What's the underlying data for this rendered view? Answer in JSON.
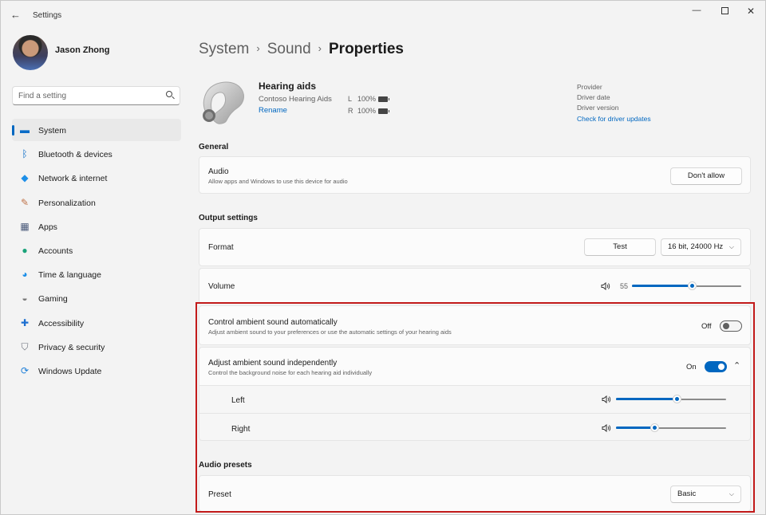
{
  "window": {
    "title": "Settings",
    "back_icon": "back-arrow-icon",
    "minimize_glyph": "—",
    "close_glyph": "✕"
  },
  "profile": {
    "name": "Jason Zhong"
  },
  "search": {
    "placeholder": "Find a setting"
  },
  "sidebar": {
    "items": [
      {
        "label": "System",
        "icon": "monitor-icon",
        "glyph": "▬",
        "color": "#0a6cc7",
        "active": true
      },
      {
        "label": "Bluetooth & devices",
        "icon": "bluetooth-icon",
        "glyph": "ᛒ",
        "color": "#0a6cc7"
      },
      {
        "label": "Network & internet",
        "icon": "wifi-icon",
        "glyph": "◆",
        "color": "#1d8fe8"
      },
      {
        "label": "Personalization",
        "icon": "brush-icon",
        "glyph": "✎",
        "color": "#c0744a"
      },
      {
        "label": "Apps",
        "icon": "apps-icon",
        "glyph": "▦",
        "color": "#4a5a7a"
      },
      {
        "label": "Accounts",
        "icon": "person-icon",
        "glyph": "●",
        "color": "#1aa37a"
      },
      {
        "label": "Time & language",
        "icon": "globe-icon",
        "glyph": "◕",
        "color": "#1d8fe8"
      },
      {
        "label": "Gaming",
        "icon": "gamepad-icon",
        "glyph": "◒",
        "color": "#7a7a7a"
      },
      {
        "label": "Accessibility",
        "icon": "accessibility-icon",
        "glyph": "✚",
        "color": "#1d6fd0"
      },
      {
        "label": "Privacy & security",
        "icon": "shield-icon",
        "glyph": "⛉",
        "color": "#6a6f7a"
      },
      {
        "label": "Windows Update",
        "icon": "update-icon",
        "glyph": "⟳",
        "color": "#1d7fd8"
      }
    ]
  },
  "breadcrumb": {
    "part1": "System",
    "part2": "Sound",
    "current": "Properties",
    "sep": "›"
  },
  "device": {
    "name": "Hearing aids",
    "manufacturer": "Contoso Hearing Aids",
    "rename": "Rename",
    "left": {
      "side": "L",
      "battery": "100%"
    },
    "right": {
      "side": "R",
      "battery": "100%"
    },
    "provider": "Provider",
    "driver_date": "Driver date",
    "driver_version": "Driver version",
    "check_updates": "Check for driver updates"
  },
  "general": {
    "heading": "General",
    "audio_title": "Audio",
    "audio_desc": "Allow apps and Windows to use this device for audio",
    "audio_button": "Don't allow"
  },
  "output": {
    "heading": "Output settings",
    "format_label": "Format",
    "test_button": "Test",
    "format_value": "16 bit, 24000 Hz",
    "volume_label": "Volume",
    "volume_value": "55",
    "volume_level": 0.55
  },
  "ambient": {
    "auto_title": "Control ambient sound automatically",
    "auto_desc": "Adjust ambient sound to your preferences or use the automatic settings of your hearing aids",
    "auto_state": "Off",
    "indep_title": "Adjust ambient sound independently",
    "indep_desc": "Control the background noise for each hearing aid individually",
    "indep_state": "On",
    "left_label": "Left",
    "left_level": 0.55,
    "right_label": "Right",
    "right_level": 0.35
  },
  "presets": {
    "heading": "Audio presets",
    "preset_label": "Preset",
    "preset_value": "Basic"
  },
  "colors": {
    "accent": "#0067c0",
    "highlight_border": "#c21a1a"
  }
}
